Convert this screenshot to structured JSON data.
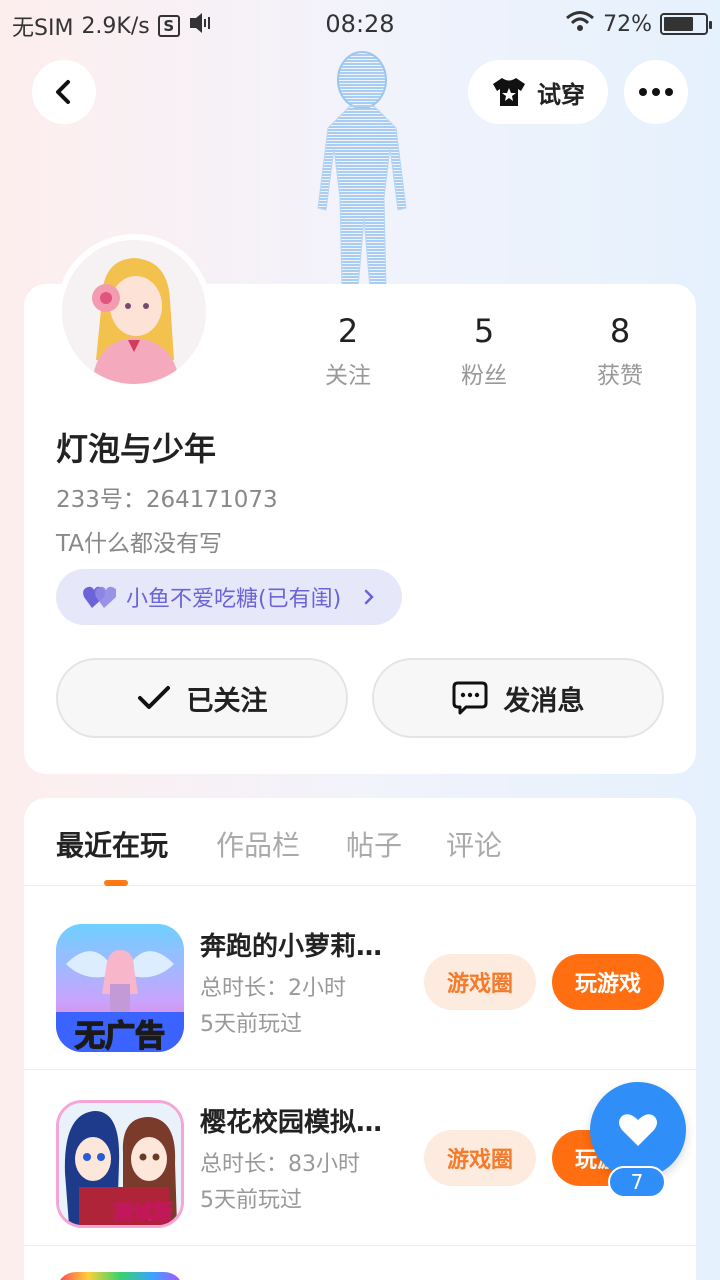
{
  "status_bar": {
    "carrier": "无SIM",
    "speed": "2.9K/s",
    "s_box": "S",
    "time": "08:28",
    "battery": "72%",
    "battery_level": 0.72
  },
  "header": {
    "back_icon": "chevron-left-icon",
    "try_on_label": "试穿",
    "try_on_icon": "tshirt-icon",
    "more_icon": "more-dots-icon"
  },
  "profile": {
    "username": "灯泡与少年",
    "user_id": "233号：264171073",
    "bio": "TA什么都没有写",
    "stats": [
      {
        "num": "2",
        "label": "关注"
      },
      {
        "num": "5",
        "label": "粉丝"
      },
      {
        "num": "8",
        "label": "获赞"
      }
    ],
    "cp_label": "小鱼不爱吃糖(已有闺)",
    "follow_label": "已关注",
    "message_label": "发消息"
  },
  "tabs": [
    {
      "label": "最近在玩",
      "active": true
    },
    {
      "label": "作品栏",
      "active": false
    },
    {
      "label": "帖子",
      "active": false
    },
    {
      "label": "评论",
      "active": false
    }
  ],
  "games": [
    {
      "title": "奔跑的小萝莉…",
      "duration": "总时长：2小时",
      "last_played": "5天前玩过",
      "icon_text": "无广告",
      "circle_label": "游戏圈",
      "play_label": "玩游戏"
    },
    {
      "title": "樱花校园模拟…",
      "duration": "总时长：83小时",
      "last_played": "5天前玩过",
      "icon_text": "测试版",
      "circle_label": "游戏圈",
      "play_label": "玩游戏"
    }
  ],
  "fab": {
    "icon": "heart-icon",
    "count": "7"
  },
  "colors": {
    "accent_orange": "#ff6e10",
    "accent_blue": "#2f8ef7",
    "cp_purple": "#6c63d8"
  }
}
